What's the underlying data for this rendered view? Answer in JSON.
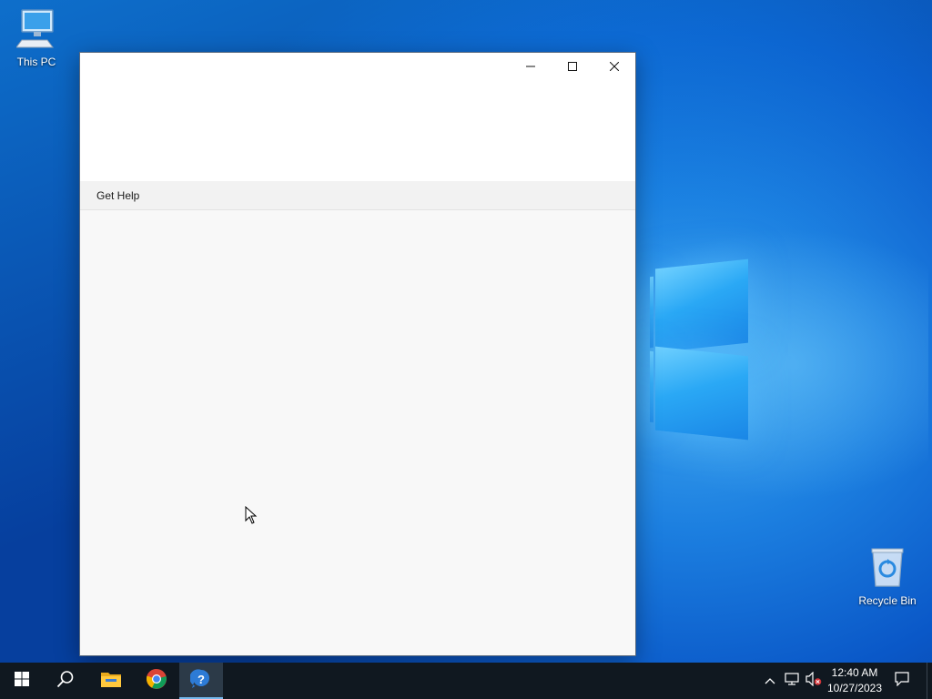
{
  "desktop": {
    "icons": [
      {
        "label": "This PC",
        "icon": "computer-icon"
      },
      {
        "label": "Recycle Bin",
        "icon": "recycle-bin-icon"
      }
    ]
  },
  "window": {
    "app_title": "Get Help",
    "controls": {
      "minimize": "minimize-icon",
      "maximize": "maximize-icon",
      "close": "close-icon"
    }
  },
  "taskbar": {
    "buttons": [
      {
        "name": "start",
        "icon": "windows-start-icon"
      },
      {
        "name": "search",
        "icon": "search-icon"
      },
      {
        "name": "file-explorer",
        "icon": "folder-icon"
      },
      {
        "name": "chrome",
        "icon": "chrome-icon"
      },
      {
        "name": "get-help",
        "icon": "get-help-icon",
        "active": true
      }
    ],
    "tray": {
      "icons": [
        "chevron-up-icon",
        "network-icon",
        "volume-muted-icon"
      ],
      "time": "12:40 AM",
      "date": "10/27/2023",
      "notification_icon": "notification-icon"
    }
  },
  "colors": {
    "accent": "#76b9ed",
    "taskbar_bg": "#101820",
    "window_bg": "#f8f8f8"
  }
}
